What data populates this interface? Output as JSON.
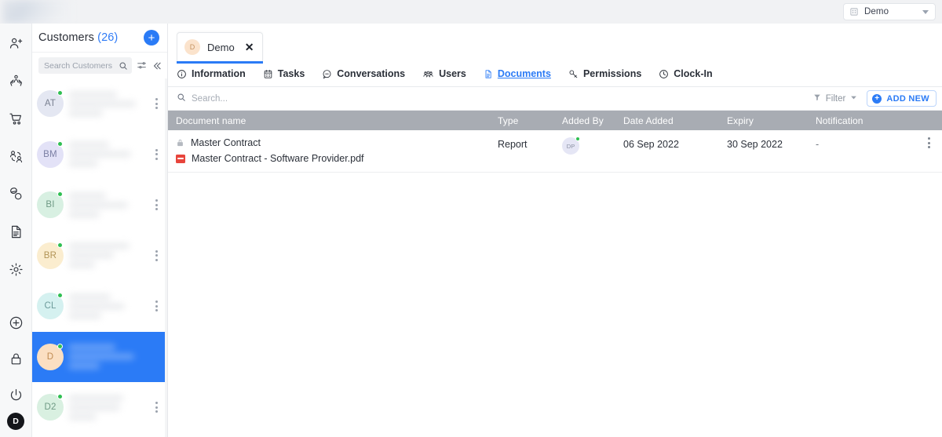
{
  "topbar": {
    "logo_name": "brand-logo",
    "company": {
      "icon": "building-icon",
      "label": "Demo",
      "chevron": "chevron-down-icon"
    }
  },
  "rail": {
    "top_icons": [
      {
        "name": "add-person-icon",
        "title": "Add Customer"
      },
      {
        "name": "hands-support-icon",
        "title": "Support"
      },
      {
        "name": "shopping-cart-icon",
        "title": "Orders"
      },
      {
        "name": "people-transfer-icon",
        "title": "Contacts"
      },
      {
        "name": "capsule-icon",
        "title": "Products"
      },
      {
        "name": "document-icon",
        "title": "Documents"
      },
      {
        "name": "gear-icon",
        "title": "Settings"
      }
    ],
    "bottom_icons": [
      {
        "name": "plus-circle-icon",
        "title": "Add"
      },
      {
        "name": "lock-icon",
        "title": "Lock"
      },
      {
        "name": "power-icon",
        "title": "Sign out"
      }
    ],
    "avatar": {
      "initials": "D"
    }
  },
  "customers": {
    "title": "Customers",
    "count": "(26)",
    "add_button": "+",
    "search": {
      "placeholder": "Search Customers",
      "search_icon": "search-icon",
      "filter_icon": "sliders-icon",
      "collapse_icon": "chevrons-left-icon"
    },
    "items": [
      {
        "initials": "AT",
        "color": "#e4e7f2",
        "text_color": "#7a8091",
        "online": true,
        "selected": false
      },
      {
        "initials": "BM",
        "color": "#e3e2f7",
        "text_color": "#7b7fa4",
        "online": true,
        "selected": false
      },
      {
        "initials": "BI",
        "color": "#d8f0e2",
        "text_color": "#6f9a85",
        "online": true,
        "selected": false
      },
      {
        "initials": "BR",
        "color": "#fbedcf",
        "text_color": "#b29457",
        "online": true,
        "selected": false
      },
      {
        "initials": "CL",
        "color": "#d5f1f0",
        "text_color": "#6d9b9b",
        "online": true,
        "selected": false
      },
      {
        "initials": "D",
        "color": "#fbdfc2",
        "text_color": "#c08c54",
        "online": true,
        "selected": true
      },
      {
        "initials": "D2",
        "color": "#d9f0e1",
        "text_color": "#6f9a85",
        "online": true,
        "selected": false
      }
    ]
  },
  "doc_tab": {
    "avatar_initials": "D",
    "label": "Demo",
    "close": "✕"
  },
  "nav_tabs": [
    {
      "icon": "info-circle-icon",
      "label": "Information",
      "active": false
    },
    {
      "icon": "clipboard-icon",
      "label": "Tasks",
      "active": false
    },
    {
      "icon": "chat-bubble-icon",
      "label": "Conversations",
      "active": false
    },
    {
      "icon": "users-icon",
      "label": "Users",
      "active": false
    },
    {
      "icon": "file-icon",
      "label": "Documents",
      "active": true
    },
    {
      "icon": "key-icon",
      "label": "Permissions",
      "active": false
    },
    {
      "icon": "clock-icon",
      "label": "Clock-In",
      "active": false
    }
  ],
  "toolbar": {
    "search_placeholder": "Search...",
    "search_icon": "search-icon",
    "filter_label": "Filter",
    "filter_icon": "funnel-icon",
    "filter_chevron": "chevron-down-icon",
    "add_new_label": "ADD NEW",
    "add_new_icon": "plus-circle-icon"
  },
  "table": {
    "headers": {
      "name": "Document name",
      "type": "Type",
      "added_by": "Added By",
      "date_added": "Date Added",
      "expiry": "Expiry",
      "notification": "Notification"
    },
    "rows": [
      {
        "lock_icon": "lock-icon",
        "name": "Master Contract",
        "file_icon": "pdf-icon",
        "file_name": "Master Contract - Software Provider.pdf",
        "type": "Report",
        "added_by_initials": "DP",
        "added_by_online": true,
        "date_added": "06 Sep 2022",
        "expiry": "30 Sep 2022",
        "notification": "-",
        "kebab": "more-vertical-icon"
      }
    ]
  },
  "colors": {
    "accent": "#2b7bf6",
    "header_bg": "#a8acb3",
    "online": "#2fbf52",
    "pdf_red": "#e8453c"
  }
}
